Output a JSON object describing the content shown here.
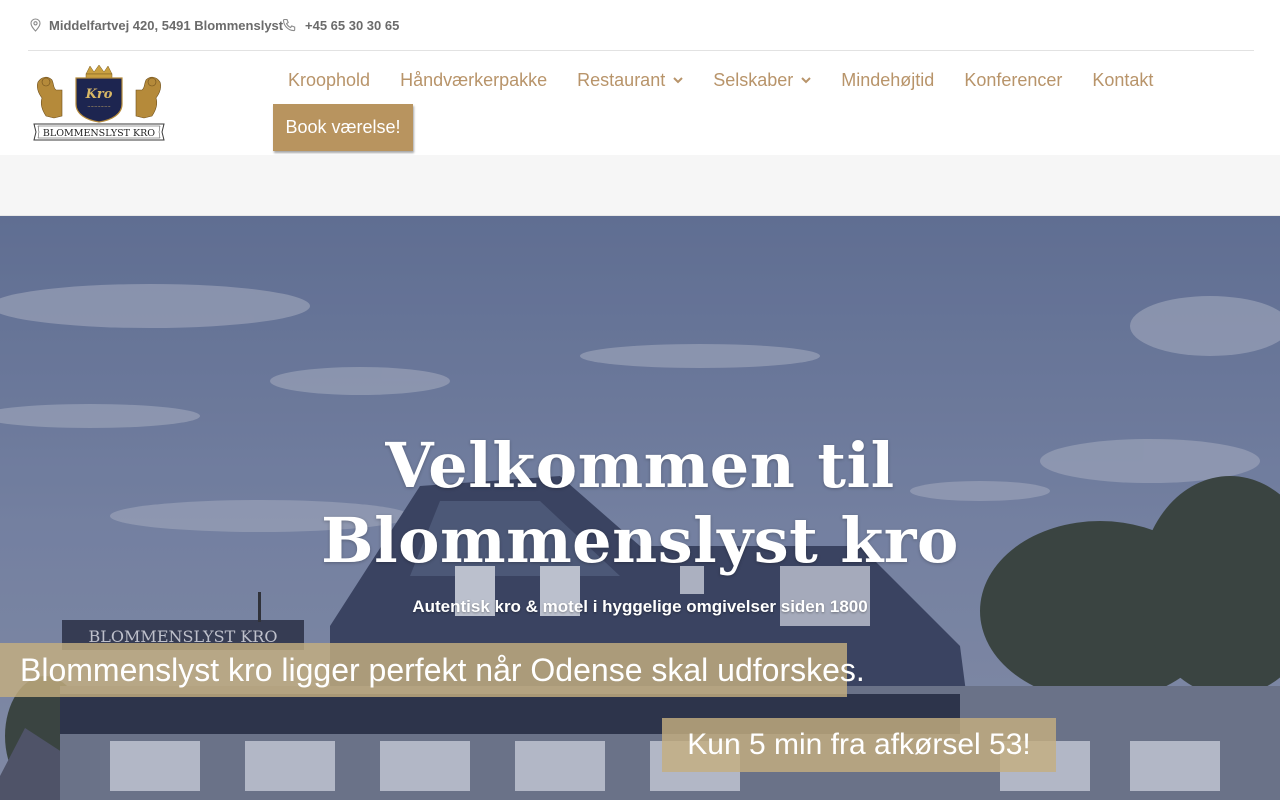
{
  "topbar": {
    "address": "Middelfartvej 420, 5491 Blommenslyst",
    "phone": "+45 65 30 30 65",
    "address_icon": "map-pin-icon",
    "phone_icon": "phone-icon"
  },
  "logo": {
    "emblem_text": "Kro",
    "banner_text": "BLOMMENSLYST KRO"
  },
  "nav": {
    "items": [
      {
        "label": "Kroophold"
      },
      {
        "label": "Håndværkerpakke"
      },
      {
        "label": "Restaurant",
        "dropdown": true
      },
      {
        "label": "Selskaber",
        "dropdown": true
      },
      {
        "label": "Mindehøjtid"
      },
      {
        "label": "Konferencer"
      },
      {
        "label": "Kontakt"
      }
    ],
    "book_button": "Book værelse!"
  },
  "hero": {
    "title_line1": "Velkommen til",
    "title_line2": "Blommenslyst kro",
    "subtitle": "Autentisk kro & motel i hyggelige omgivelser  siden 1800",
    "band_text_1": "Blommenslyst kro ligger perfekt når Odense skal udforskes.",
    "band_text_2": "Kun 5 min fra afkørsel 53!",
    "building_sign": "BLOMMENSLYST KRO"
  },
  "colors": {
    "accent": "#b8945f",
    "nav_text": "#b8946a",
    "band": "#c4ae80",
    "topbar_text": "#6b6b6b"
  }
}
